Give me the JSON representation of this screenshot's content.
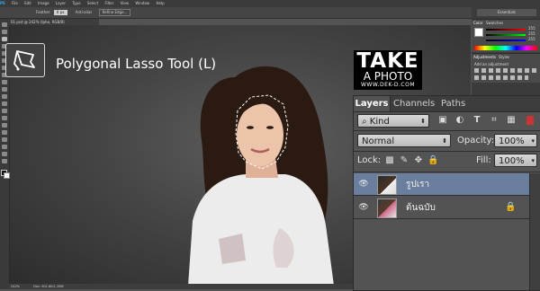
{
  "menubar": {
    "items": [
      "PS",
      "File",
      "Edit",
      "Image",
      "Layer",
      "Type",
      "Select",
      "Filter",
      "View",
      "Window",
      "Help"
    ]
  },
  "options_bar": {
    "feather_label": "Feather:",
    "feather_value": "0 px",
    "antialias_label": "Anti-alias",
    "refine_label": "Refine Edge..."
  },
  "document": {
    "tab_title": "01.psd @ 242% (Ipho, RGB/8)",
    "status_zoom": "242%",
    "status_doc": "Doc: 901.6K/1.26M"
  },
  "workspace": {
    "label": "Essentials"
  },
  "tool_callout": {
    "title": "Polygonal Lasso Tool (L)",
    "icon": "polygonal-lasso-icon"
  },
  "logo": {
    "line1": "TAKE",
    "line2": "A PHOTO",
    "line3": "WWW.DEK-D.COM"
  },
  "color_panel": {
    "tabs": [
      "Color",
      "Swatches"
    ],
    "values": [
      "255",
      "255",
      "255"
    ]
  },
  "adjustments_panel": {
    "tabs": [
      "Adjustments",
      "Styles"
    ],
    "add_label": "Add an adjustment"
  },
  "layers_panel": {
    "tabs": [
      "Layers",
      "Channels",
      "Paths"
    ],
    "filter_kind": "Kind",
    "blend_mode": "Normal",
    "opacity_label": "Opacity:",
    "opacity_value": "100%",
    "lock_label": "Lock:",
    "fill_label": "Fill:",
    "fill_value": "100%",
    "layers": [
      {
        "name": "รูปเรา",
        "selected": true,
        "locked": false
      },
      {
        "name": "ต้นฉบับ",
        "selected": false,
        "locked": true
      }
    ]
  },
  "colors": {
    "selected_layer": "#6a7f9e",
    "panel_bg": "#535353",
    "accent": "#1473e6"
  }
}
